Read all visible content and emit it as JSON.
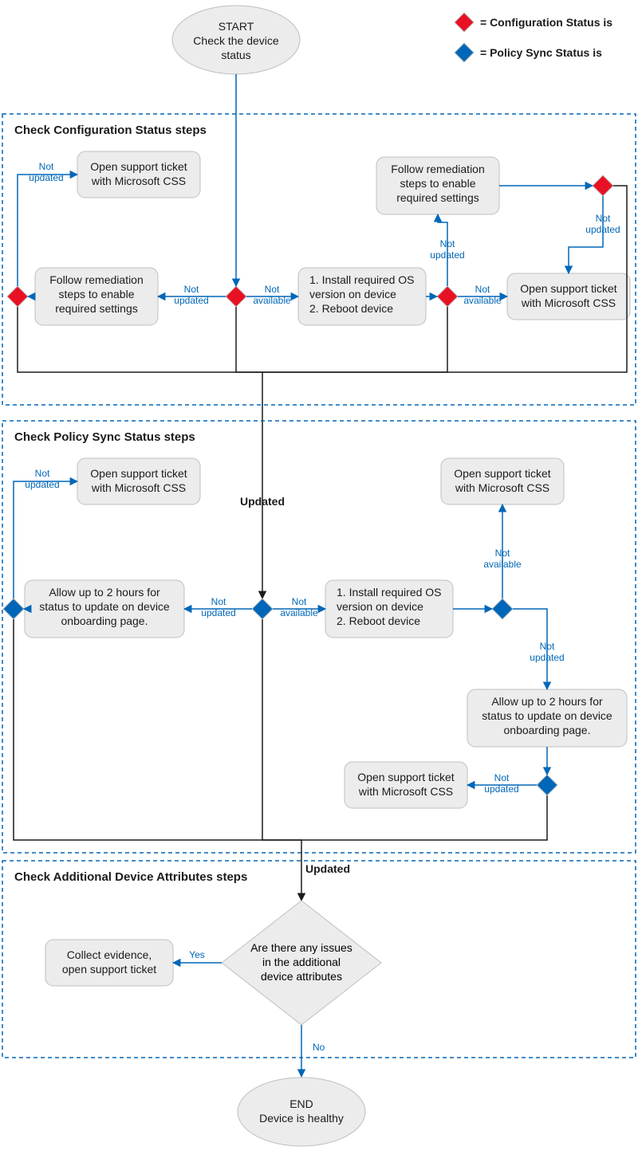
{
  "legend": {
    "red": "= Configuration Status is",
    "blue": "= Policy Sync Status is"
  },
  "start": {
    "line1": "START",
    "line2": "Check the device",
    "line3": "status"
  },
  "end": {
    "line1": "END",
    "line2": "Device is healthy"
  },
  "sections": {
    "config": "Check Configuration Status steps",
    "policy": "Check Policy Sync Status steps",
    "attrs": "Check Additional Device Attributes steps"
  },
  "labels": {
    "not_updated": "Not\nupdated",
    "not_updated_inline": "Not updated",
    "not_available": "Not\navailable",
    "not_available_inline": "Not available",
    "updated": "Updated",
    "yes": "Yes",
    "no": "No"
  },
  "nodes": {
    "open_css": "Open support ticket\nwith Microsoft CSS",
    "remediate": "Follow remediation\nsteps to enable\nrequired settings",
    "install_reboot": "1. Install required OS\n    version on device\n2. Reboot device",
    "allow_2h": "Allow up to 2 hours for\nstatus to update on device\nonboarding page.",
    "collect_evidence": "Collect evidence,\nopen support ticket",
    "attr_question": "Are there any issues\nin the additional\ndevice attributes"
  }
}
